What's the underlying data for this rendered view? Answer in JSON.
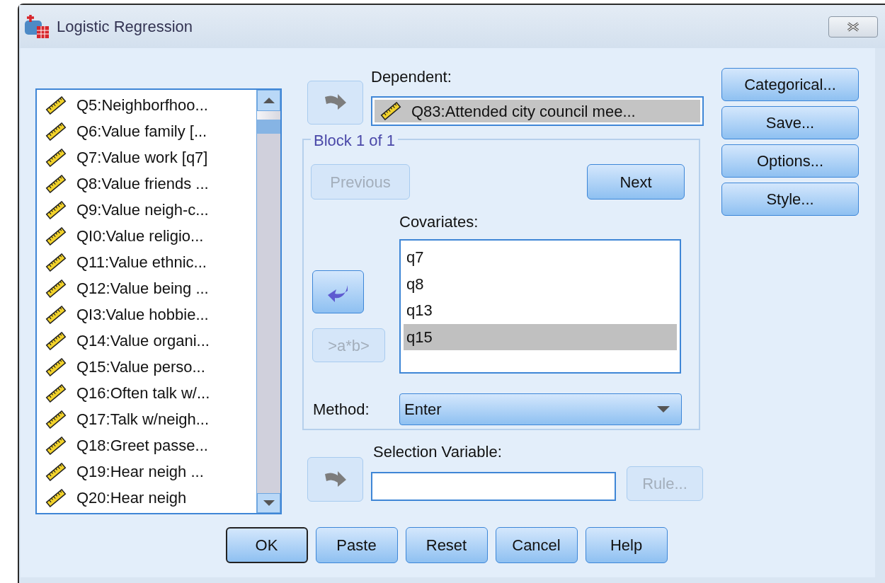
{
  "window": {
    "title": "Logistic Regression"
  },
  "variables": [
    {
      "label": "Q5:Neighborfhoo..."
    },
    {
      "label": "Q6:Value family [..."
    },
    {
      "label": "Q7:Value work [q7]"
    },
    {
      "label": "Q8:Value friends ..."
    },
    {
      "label": "Q9:Value neigh-c..."
    },
    {
      "label": "QI0:Value religio..."
    },
    {
      "label": "Q11:Value ethnic..."
    },
    {
      "label": "Q12:Value being ..."
    },
    {
      "label": "QI3:Value hobbie..."
    },
    {
      "label": "Q14:Value organi..."
    },
    {
      "label": "Q15:Value perso..."
    },
    {
      "label": "Q16:Often talk w/..."
    },
    {
      "label": "Q17:Talk w/neigh..."
    },
    {
      "label": "Q18:Greet passe..."
    },
    {
      "label": "Q19:Hear neigh ..."
    },
    {
      "label": "Q20:Hear neigh"
    }
  ],
  "dependent": {
    "label": "Dependent:",
    "value": "Q83:Attended city council mee...",
    "transfer": {
      "kind": "right",
      "disabled": true
    }
  },
  "block": {
    "title": "Block 1 of 1",
    "previous": {
      "label": "Previous",
      "disabled": true
    },
    "next": {
      "label": "Next",
      "disabled": false
    },
    "transfer": {
      "kind": "left",
      "disabled": false
    },
    "interaction": {
      "label": ">a*b>",
      "disabled": true
    },
    "covariates": {
      "label": "Covariates:",
      "items": [
        {
          "text": "q7",
          "selected": false
        },
        {
          "text": "q8",
          "selected": false
        },
        {
          "text": "q13",
          "selected": false
        },
        {
          "text": "q15",
          "selected": true
        }
      ]
    },
    "method": {
      "label": "Method:",
      "value": "Enter"
    }
  },
  "selection_variable": {
    "label": "Selection Variable:",
    "transfer": {
      "kind": "right",
      "disabled": true
    },
    "rule": {
      "label": "Rule...",
      "disabled": true
    }
  },
  "side_buttons": [
    {
      "label": "Categorical..."
    },
    {
      "label": "Save..."
    },
    {
      "label": "Options..."
    },
    {
      "label": "Style..."
    }
  ],
  "footer_buttons": [
    {
      "label": "OK",
      "default": true
    },
    {
      "label": "Paste",
      "default": false
    },
    {
      "label": "Reset",
      "default": false
    },
    {
      "label": "Cancel",
      "default": false
    },
    {
      "label": "Help",
      "default": false
    }
  ]
}
